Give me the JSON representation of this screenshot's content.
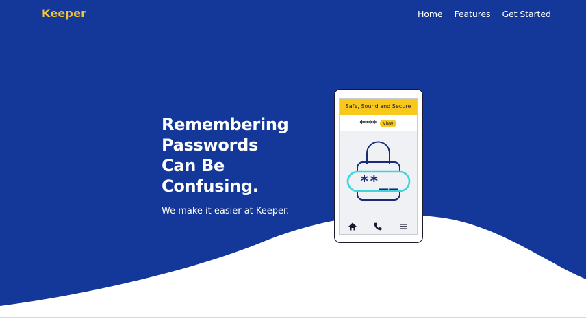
{
  "brand": {
    "name": "Keeper"
  },
  "nav": {
    "items": [
      "Home",
      "Features",
      "Get Started"
    ]
  },
  "hero": {
    "title_lines": [
      "Remembering",
      "Passwords",
      "Can Be",
      "Confusing."
    ],
    "subtitle": "We make it easier at Keeper."
  },
  "phone": {
    "banner": "Safe, Sound and Secure",
    "masked_password": "****",
    "view_label": "view",
    "lock_field_text": "**__",
    "tabbar_icons": [
      "home-icon",
      "phone-icon",
      "menu-icon"
    ]
  },
  "colors": {
    "hero_blue": "#143899",
    "accent_yellow": "#f5c431",
    "phone_banner_yellow": "#f8c81c",
    "lock_stroke": "#1a2a78",
    "lock_field_cyan": "#3fd3dc"
  }
}
